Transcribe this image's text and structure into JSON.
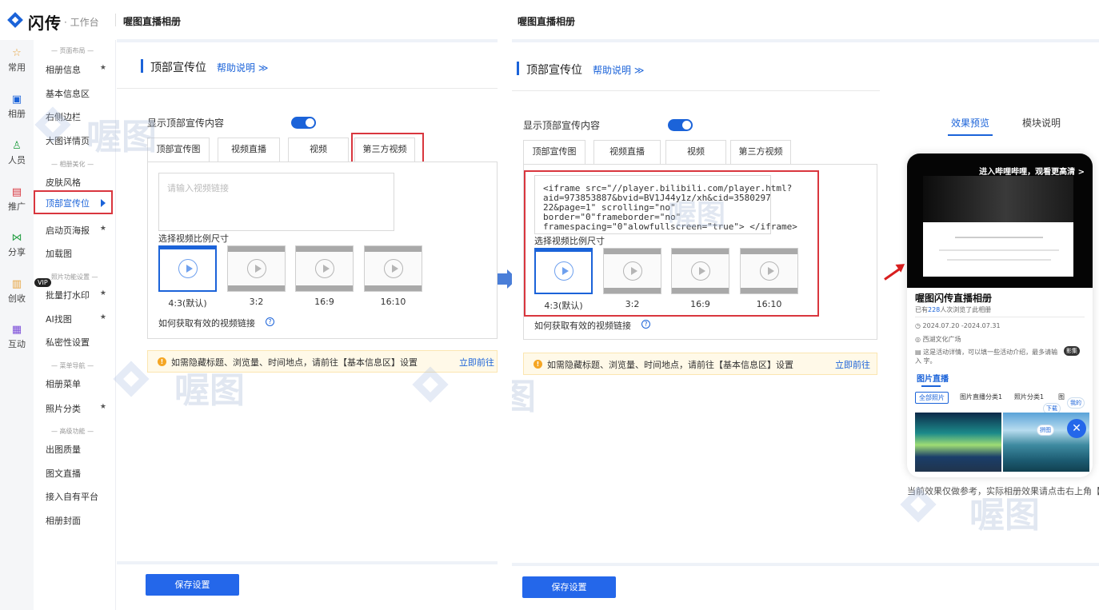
{
  "brand": {
    "name": "闪传",
    "sub": "· 工作台"
  },
  "album_title": "喔图直播相册",
  "rail": [
    {
      "label": "常用",
      "icon": "star-icon",
      "glyph": "☆",
      "color": "#e6a23c"
    },
    {
      "label": "相册",
      "icon": "album-icon",
      "glyph": "▣",
      "color": "#1b63d9"
    },
    {
      "label": "人员",
      "icon": "users-icon",
      "glyph": "♙",
      "color": "#2ca24a"
    },
    {
      "label": "推广",
      "icon": "promote-icon",
      "glyph": "▤",
      "color": "#d9363e"
    },
    {
      "label": "分享",
      "icon": "share-icon",
      "glyph": "⋈",
      "color": "#2ca24a"
    },
    {
      "label": "创收",
      "icon": "revenue-icon",
      "glyph": "▥",
      "color": "#e6a23c"
    },
    {
      "label": "互动",
      "icon": "interact-icon",
      "glyph": "▦",
      "color": "#7a4bd8"
    }
  ],
  "menu": {
    "groups": [
      "— 页面布局 —",
      "— 相册美化 —",
      "照片功能设置 —",
      "— 菜单导航 —",
      "— 高级功能 —"
    ],
    "items": [
      "相册信息",
      "基本信息区",
      "右侧边栏",
      "大图详情页",
      "皮肤风格",
      "顶部宣传位",
      "启动页海报",
      "加载图",
      "批量打水印",
      "AI找图",
      "私密性设置",
      "相册菜单",
      "照片分类",
      "出图质量",
      "图文直播",
      "接入自有平台",
      "相册封面"
    ],
    "star": "★",
    "vip": "VIP"
  },
  "section": {
    "title": "顶部宣传位",
    "help": "帮助说明 ≫"
  },
  "toggle_label": "显示顶部宣传内容",
  "tabs": [
    "顶部宣传图",
    "视频直播",
    "视频",
    "第三方视频"
  ],
  "input": {
    "placeholder": "请输入视频链接",
    "value_lines": [
      "<iframe src=\"//player.bilibili.com/player.html?",
      "aid=973853887&bvid=BV1J44y1z/xh&cid=3580297",
      "22&page=1\" scrolling=\"no\"",
      "border=\"0\"frameborder=\"no\"",
      "framespacing=\"0\"alowfullscreen=\"true\"> </iframe>"
    ]
  },
  "ratio_title": "选择视频比例尺寸",
  "ratios": [
    "4:3(默认)",
    "3:2",
    "16:9",
    "16:10"
  ],
  "how_to": "如何获取有效的视频链接",
  "notice": {
    "text": "如需隐藏标题、浏览量、时间地点，请前往【基本信息区】设置",
    "link": "立即前往"
  },
  "save": "保存设置",
  "watermark": "喔图",
  "preview": {
    "tabs": [
      "效果预览",
      "模块说明"
    ],
    "video_banner": "进入哔哩哔哩，观看更高清 >",
    "album_name": "喔图闪传直播相册",
    "visits_prefix": "已有",
    "visits_count": "228",
    "visits_suffix": "人次浏览了此相册",
    "date": "2024.07.20 -2024.07.31",
    "place": "西湖文化广场",
    "desc": "这是活动详情，可以填一些活动介绍，最多请输入 字。",
    "section": "图片直播",
    "chips": [
      "全部照片",
      "图片直播分类1",
      "照片分类1",
      "图"
    ],
    "badges": [
      "影集",
      "下载",
      "拼图",
      "我的"
    ],
    "footnote": "当前效果仅做参考，实际相册效果请点击右上角【预览】"
  },
  "colors": {
    "primary": "#2467ea",
    "highlight": "#d9363e",
    "notice_bg": "#fff9e8",
    "warn": "#f5a623"
  }
}
